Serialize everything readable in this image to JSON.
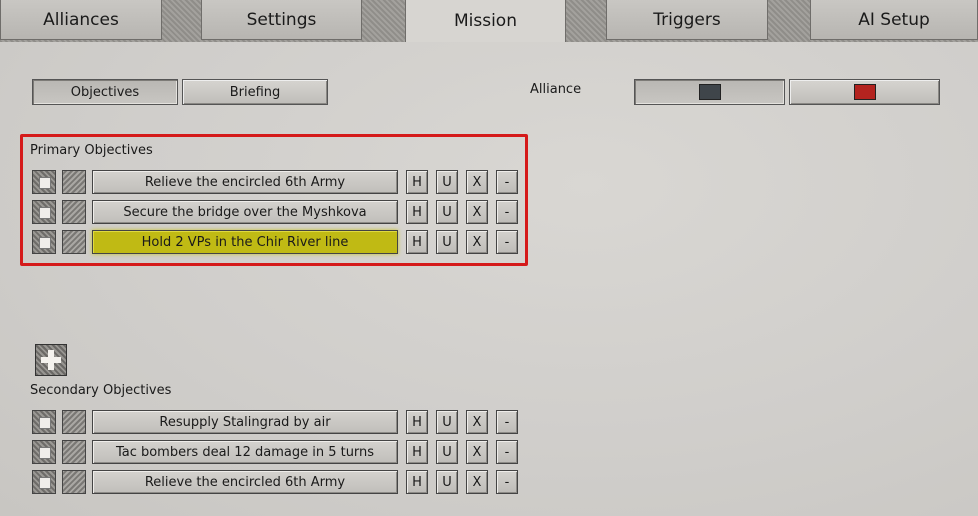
{
  "tabs": [
    {
      "label": "Alliances"
    },
    {
      "label": "Settings"
    },
    {
      "label": "Mission"
    },
    {
      "label": "Triggers"
    },
    {
      "label": "AI Setup"
    }
  ],
  "subtabs": {
    "objectives": "Objectives",
    "briefing": "Briefing"
  },
  "alliance": {
    "label": "Alliance",
    "colors": [
      "#3f454a",
      "#b3231f"
    ]
  },
  "primary": {
    "title": "Primary Objectives",
    "items": [
      {
        "name": "Relieve the encircled 6th Army",
        "highlighted": false
      },
      {
        "name": "Secure the bridge over the Myshkova",
        "highlighted": false
      },
      {
        "name": "Hold 2 VPs in the Chir River line",
        "highlighted": true
      }
    ]
  },
  "secondary": {
    "title": "Secondary Objectives",
    "items": [
      {
        "name": "Resupply Stalingrad by air"
      },
      {
        "name": "Tac bombers deal 12 damage in 5 turns"
      },
      {
        "name": "Relieve the encircled 6th Army"
      }
    ]
  },
  "row_buttons": [
    "H",
    "U",
    "X",
    "-"
  ],
  "highlight_color": "#c0ba14",
  "callout_color": "#d51a1a"
}
